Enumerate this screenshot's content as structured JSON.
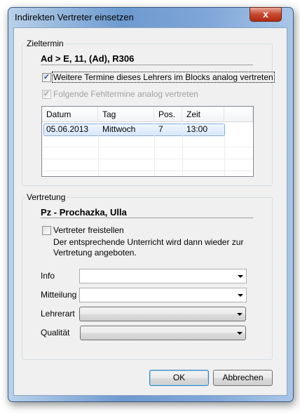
{
  "window": {
    "title": "Indirekten Vertreter einsetzen",
    "close_label": "x"
  },
  "zieltermin": {
    "group_label": "Zieltermin",
    "lesson": "Ad > E, 11, (Ad), R306",
    "checkbox_block": {
      "label": "Weitere Termine dieses Lehrers im Blocks analog vertreten",
      "checked": true
    },
    "checkbox_follow": {
      "label": "Folgende Fehltermine analog vertreten",
      "checked": true,
      "disabled": true
    },
    "table": {
      "columns": [
        "Datum",
        "Tag",
        "Pos.",
        "Zeit"
      ],
      "rows": [
        [
          "05.06.2013",
          "Mittwoch",
          "7",
          "13:00"
        ]
      ]
    }
  },
  "vertretung": {
    "group_label": "Vertretung",
    "teacher": "Pz - Prochazka, Ulla",
    "checkbox_free": {
      "label": "Vertreter freistellen",
      "checked": false
    },
    "description_line1": "Der entsprechende Unterricht wird dann wieder zur",
    "description_line2": "Vertretung angeboten.",
    "fields": {
      "info": "Info",
      "mitteilung": "Mitteilung",
      "lehrerart": "Lehrerart",
      "qualitaet": "Qualität"
    }
  },
  "buttons": {
    "ok": "OK",
    "cancel": "Abbrechen"
  },
  "check_glyph": "✓"
}
